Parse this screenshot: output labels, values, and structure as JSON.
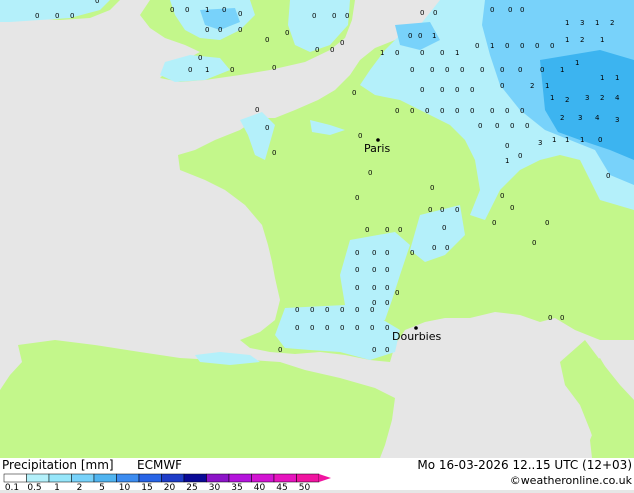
{
  "map": {
    "colors": {
      "sea": "#e6e6e6",
      "land": "#c3f78b",
      "precip_light": "#b4f0fa",
      "precip_medium": "#78d2fa",
      "precip_heavy": "#3cb4f0"
    },
    "cities": [
      {
        "name": "Paris"
      },
      {
        "name": "Dourbies"
      }
    ],
    "precip_value_labels": [
      "0",
      "1",
      "2",
      "3",
      "4"
    ]
  },
  "footer": {
    "title": "Precipitation [mm]",
    "model": "ECMWF",
    "datetime": "Mo 16-03-2026 12..15 UTC (12+03)",
    "copyright": "©weatheronline.co.uk",
    "scale": {
      "labels": [
        "0.1",
        "0.5",
        "1",
        "2",
        "5",
        "10",
        "15",
        "20",
        "25",
        "30",
        "35",
        "40",
        "45",
        "50"
      ],
      "colors": [
        "#ffffff",
        "#b4f0fa",
        "#96e6fa",
        "#78d2fa",
        "#50b4f0",
        "#3c8cf0",
        "#2864e6",
        "#1e3cc8",
        "#0a0a96",
        "#8c14c8",
        "#b414dc",
        "#d214d2",
        "#e614be",
        "#f014a0"
      ]
    }
  }
}
